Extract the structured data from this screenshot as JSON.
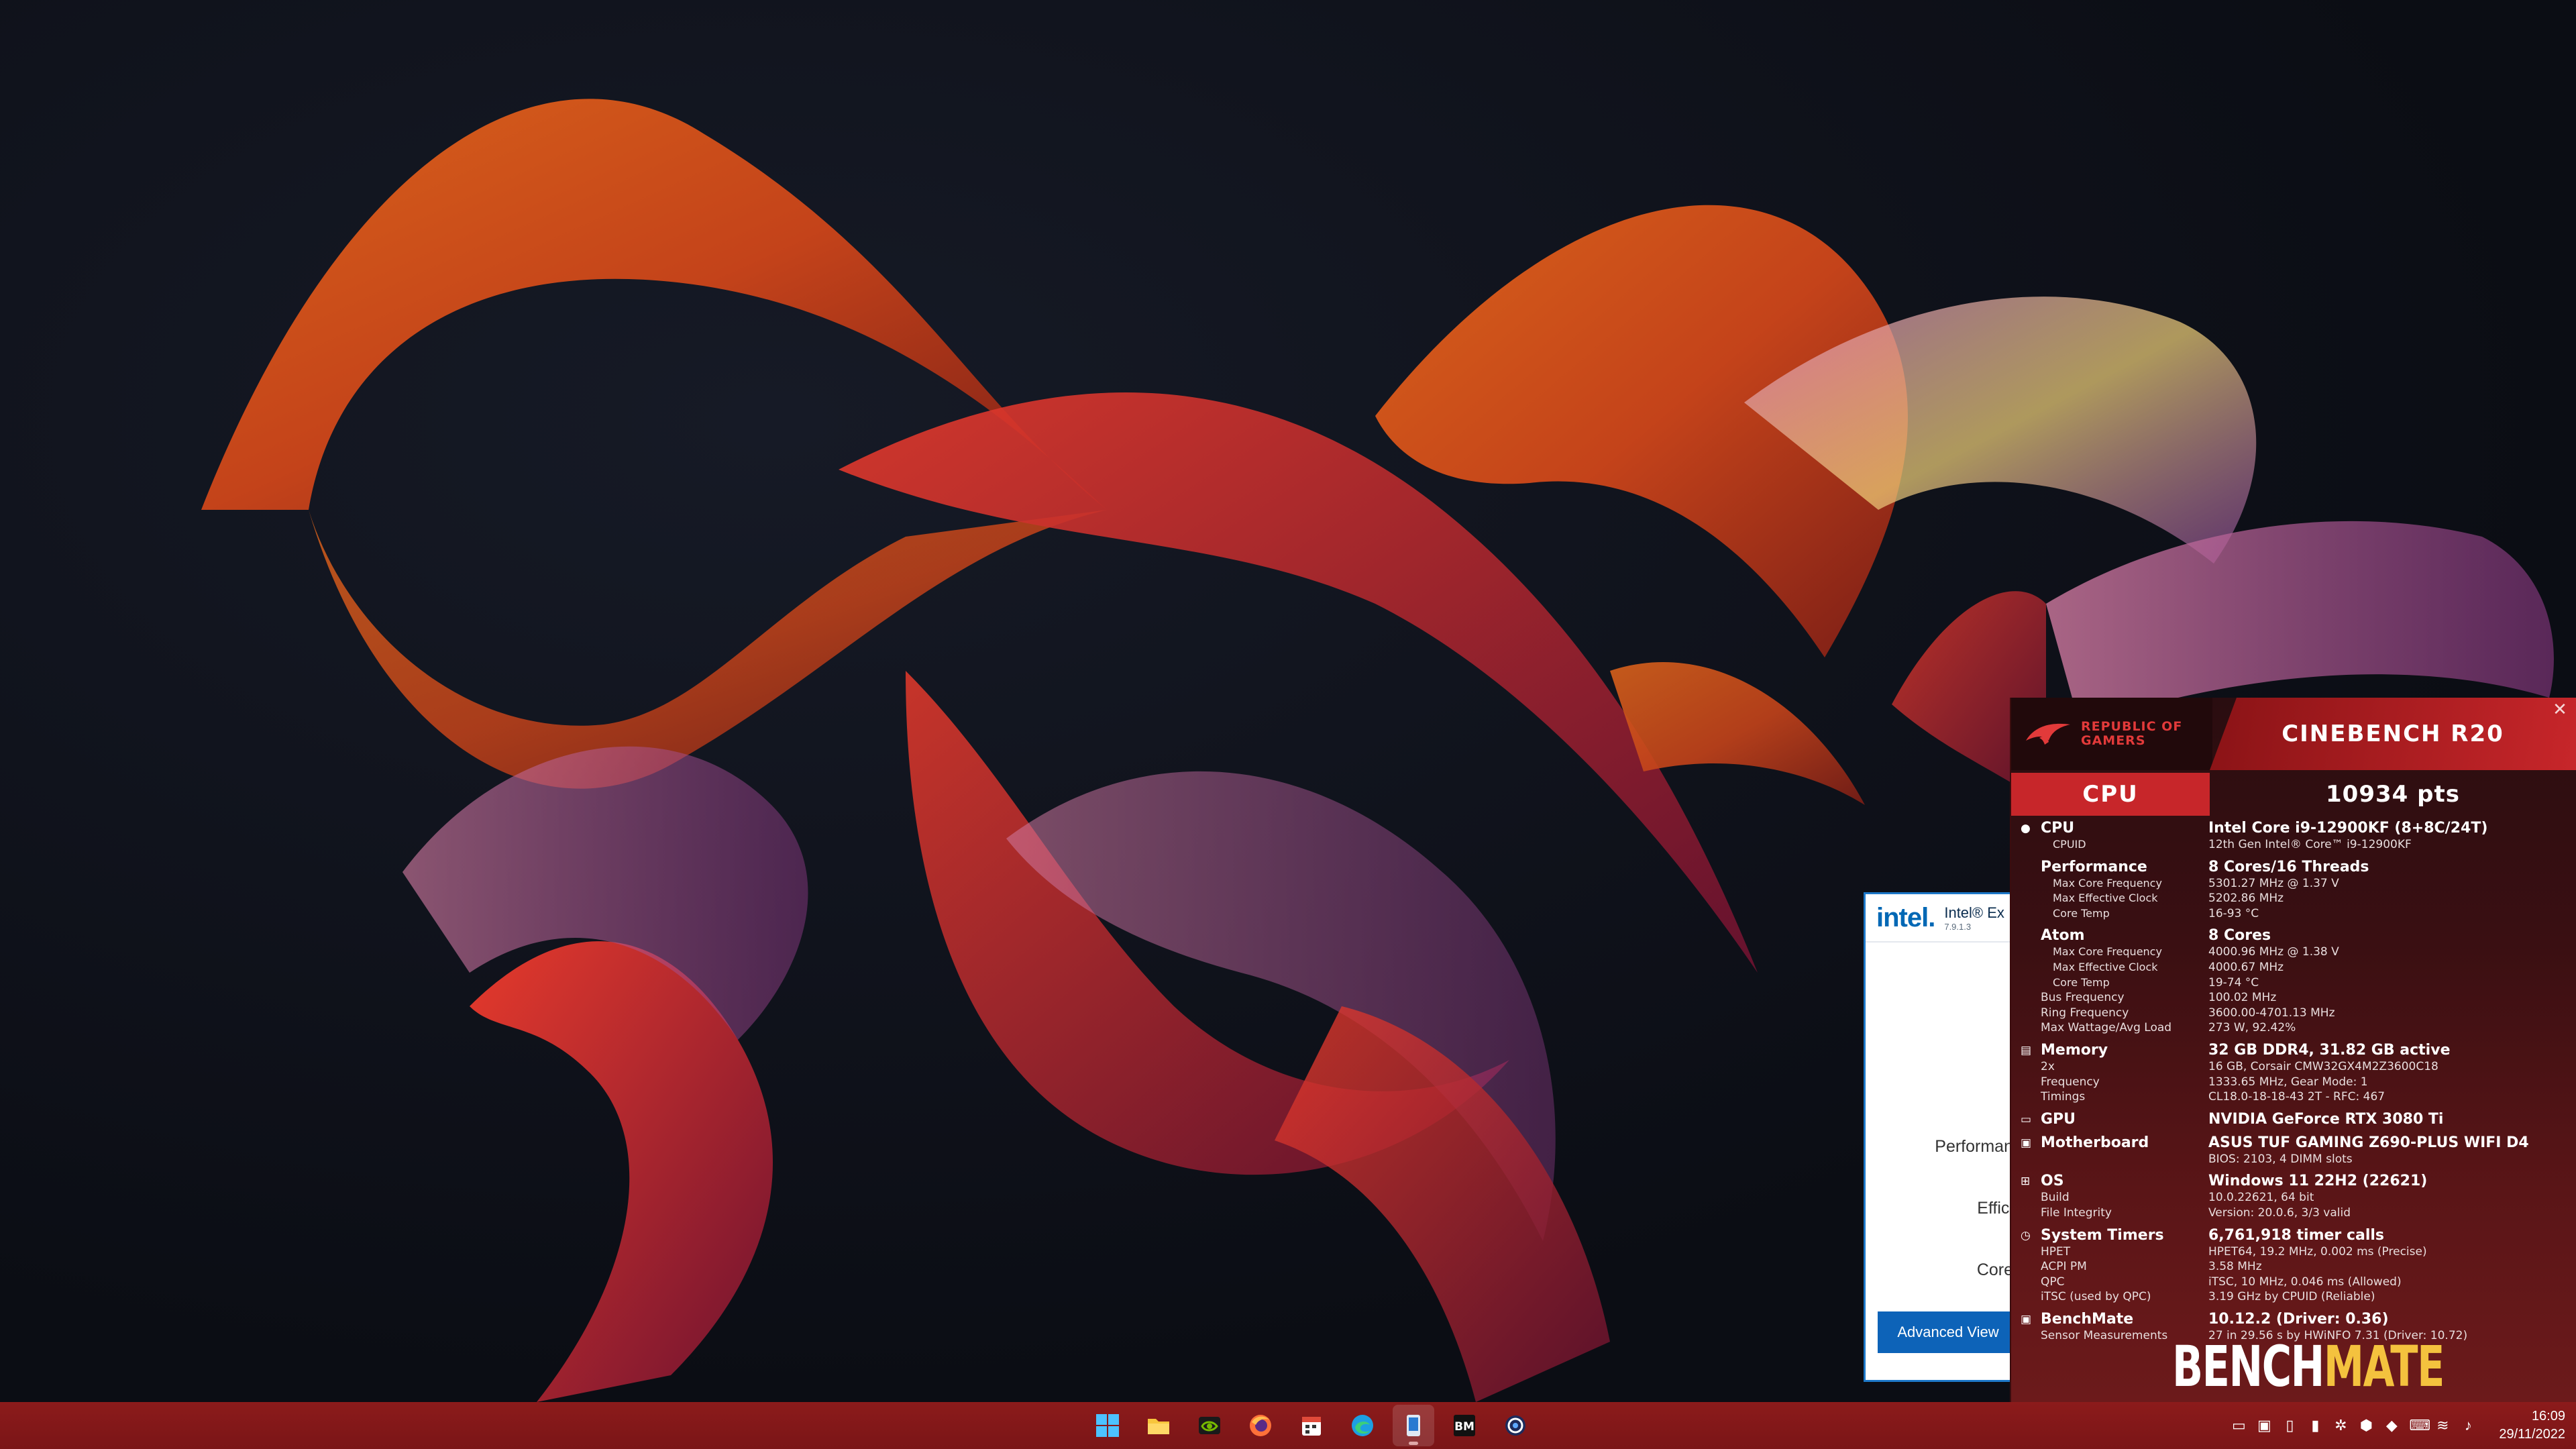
{
  "xtu": {
    "logo": "intel.",
    "title": "Intel® Ex",
    "version": "7.9.1.3",
    "labels": [
      "Performan",
      "Effici",
      "Core"
    ],
    "advanced_view": "Advanced View"
  },
  "bench": {
    "rog_text_1": "REPUBLIC OF",
    "rog_text_2": "GAMERS",
    "title": "CINEBENCH R20",
    "score_type": "CPU",
    "score": "10934 pts",
    "close": "✕",
    "rows": [
      {
        "k": "CPU",
        "v": "Intel Core i9-12900KF (8+8C/24T)",
        "style": "main",
        "icon": "●",
        "icon_name": "cpu-icon"
      },
      {
        "k": "CPUID",
        "v": "12th Gen Intel® Core™ i9-12900KF",
        "style": "sub"
      },
      {
        "k": "Performance",
        "v": "8 Cores/16 Threads",
        "style": "main"
      },
      {
        "k": "Max Core Frequency",
        "v": "5301.27 MHz @ 1.37 V",
        "style": "sub"
      },
      {
        "k": "Max Effective Clock",
        "v": "5202.86 MHz",
        "style": "sub"
      },
      {
        "k": "Core Temp",
        "v": "16-93 °C",
        "style": "sub"
      },
      {
        "k": "Atom",
        "v": "8 Cores",
        "style": "main"
      },
      {
        "k": "Max Core Frequency",
        "v": "4000.96 MHz @ 1.38 V",
        "style": "sub"
      },
      {
        "k": "Max Effective Clock",
        "v": "4000.67 MHz",
        "style": "sub"
      },
      {
        "k": "Core Temp",
        "v": "19-74 °C",
        "style": "sub"
      },
      {
        "k": "Bus Frequency",
        "v": "100.02 MHz",
        "style": "plain"
      },
      {
        "k": "Ring Frequency",
        "v": "3600.00-4701.13 MHz",
        "style": "plain"
      },
      {
        "k": "Max Wattage/Avg Load",
        "v": "273 W, 92.42%",
        "style": "plain"
      },
      {
        "k": "Memory",
        "v": "32 GB DDR4, 31.82 GB active",
        "style": "main",
        "icon": "▤",
        "icon_name": "memory-icon"
      },
      {
        "k": "2x",
        "v": "16 GB, Corsair CMW32GX4M2Z3600C18",
        "style": "plain"
      },
      {
        "k": "Frequency",
        "v": "1333.65 MHz, Gear Mode: 1",
        "style": "plain"
      },
      {
        "k": "Timings",
        "v": "CL18.0-18-18-43 2T - RFC: 467",
        "style": "plain"
      },
      {
        "k": "GPU",
        "v": "NVIDIA GeForce RTX 3080 Ti",
        "style": "main",
        "icon": "▭",
        "icon_name": "gpu-icon"
      },
      {
        "k": "Motherboard",
        "v": "ASUS TUF GAMING Z690-PLUS WIFI D4",
        "style": "main",
        "icon": "▣",
        "icon_name": "motherboard-icon"
      },
      {
        "k": "",
        "v": "BIOS: 2103, 4 DIMM slots",
        "style": "plain"
      },
      {
        "k": "OS",
        "v": "Windows 11 22H2 (22621)",
        "style": "main",
        "icon": "⊞",
        "icon_name": "windows-icon"
      },
      {
        "k": "Build",
        "v": "10.0.22621, 64 bit",
        "style": "plain"
      },
      {
        "k": "File Integrity",
        "v": "Version: 20.0.6, 3/3 valid",
        "style": "plain"
      },
      {
        "k": "System Timers",
        "v": "6,761,918 timer calls",
        "style": "main",
        "icon": "◷",
        "icon_name": "timer-icon"
      },
      {
        "k": "HPET",
        "v": "HPET64, 19.2 MHz, 0.002 ms (Precise)",
        "style": "plain"
      },
      {
        "k": "ACPI PM",
        "v": "3.58 MHz",
        "style": "plain"
      },
      {
        "k": "QPC",
        "v": "iTSC, 10 MHz, 0.046 ms (Allowed)",
        "style": "plain"
      },
      {
        "k": "iTSC (used by QPC)",
        "v": "3.19 GHz by CPUID (Reliable)",
        "style": "plain"
      },
      {
        "k": "BenchMate",
        "v": "10.12.2 (Driver: 0.36)",
        "style": "main",
        "icon": "▣",
        "icon_name": "benchmate-icon"
      },
      {
        "k": "Sensor Measurements",
        "v": "27 in 29.56 s by HWiNFO 7.31 (Driver: 10.72)",
        "style": "plain"
      }
    ],
    "logo_part_1": "BENCH",
    "logo_part_2": "MATE"
  },
  "taskbar": {
    "apps": [
      {
        "name": "start-button",
        "icon": "windows-logo"
      },
      {
        "name": "file-explorer-button",
        "icon": "folder-icon"
      },
      {
        "name": "nvidia-button",
        "icon": "nvidia-icon"
      },
      {
        "name": "firefox-button",
        "icon": "firefox-icon"
      },
      {
        "name": "calendar-app-button",
        "icon": "calendar-icon"
      },
      {
        "name": "edge-button",
        "icon": "edge-icon"
      },
      {
        "name": "xtu-button",
        "icon": "xtu-icon"
      },
      {
        "name": "benchmate-button",
        "icon": "bm-icon"
      },
      {
        "name": "cinebench-button",
        "icon": "cinebench-icon"
      }
    ],
    "bm_label": "BM",
    "time": "16:09",
    "date": "29/11/2022"
  },
  "colors": {
    "taskbar": "#8c1b1b",
    "bench_accent": "#c7262a",
    "xtu_blue": "#0d63b8"
  }
}
